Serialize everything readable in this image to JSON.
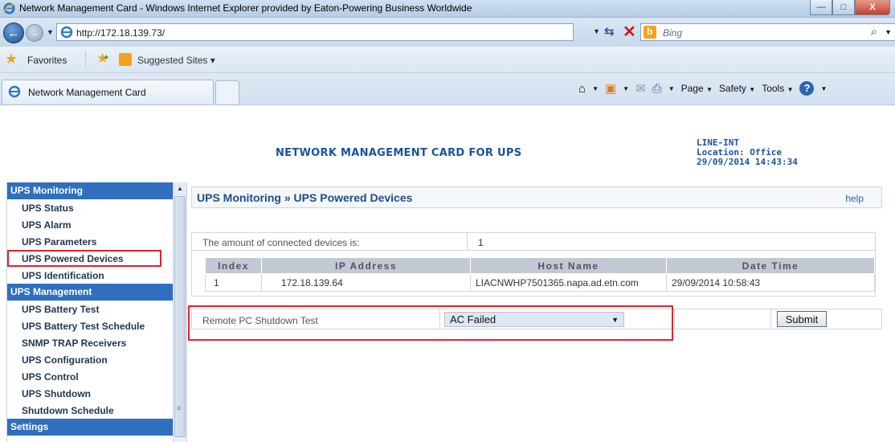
{
  "window": {
    "title": "Network Management Card - Windows Internet Explorer provided by Eaton-Powering Business Worldwide",
    "minimize": "—",
    "maximize": "□",
    "close": "X"
  },
  "address_bar": {
    "url": "http://172.18.139.73/",
    "search_placeholder": "Bing"
  },
  "favorites_bar": {
    "favorites_label": "Favorites",
    "suggested_label": "Suggested Sites ▾"
  },
  "tab": {
    "label": "Network Management Card"
  },
  "command_bar": {
    "page": "Page",
    "safety": "Safety",
    "tools": "Tools",
    "help": "?"
  },
  "header": {
    "title": "NETWORK MANAGEMENT CARD FOR UPS",
    "device_name": "LINE-INT",
    "location": "Location: Office",
    "datetime": "29/09/2014 14:43:34"
  },
  "sidebar": {
    "sections": [
      {
        "heading": "UPS Monitoring",
        "items": [
          "UPS Status",
          "UPS Alarm",
          "UPS Parameters",
          "UPS Powered Devices",
          "UPS Identification"
        ]
      },
      {
        "heading": "UPS Management",
        "items": [
          "UPS Battery Test",
          "UPS Battery Test Schedule",
          "SNMP TRAP Receivers",
          "UPS Configuration",
          "UPS Control",
          "UPS Shutdown",
          "Shutdown Schedule"
        ]
      },
      {
        "heading": "Settings",
        "items": []
      }
    ],
    "highlighted_item": "UPS Powered Devices"
  },
  "main": {
    "breadcrumb": "UPS Monitoring » UPS Powered Devices",
    "help_link": "help",
    "connected_label": "The amount of connected devices is:",
    "connected_count": "1",
    "table": {
      "headers": [
        "Index",
        "IP Address",
        "Host Name",
        "Date Time"
      ],
      "rows": [
        [
          "1",
          "172.18.139.64",
          "LIACNWHP7501365.napa.ad.etn.com",
          "29/09/2014 10:58:43"
        ]
      ]
    },
    "shutdown_test": {
      "label": "Remote PC Shutdown Test",
      "selected": "AC Failed",
      "submit": "Submit"
    }
  }
}
